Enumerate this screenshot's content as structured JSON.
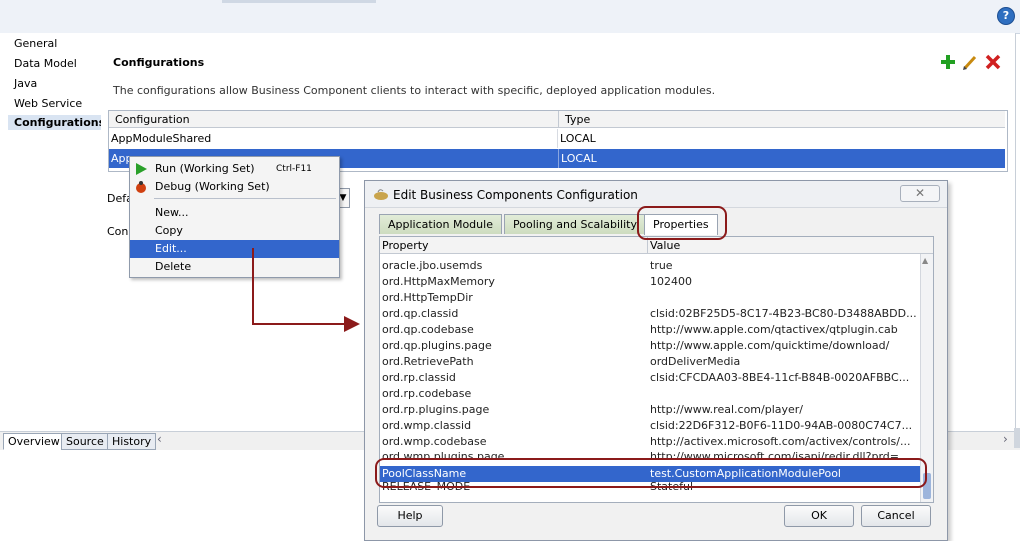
{
  "nav": {
    "items": [
      {
        "label": "General",
        "selected": false
      },
      {
        "label": "Data Model",
        "selected": false
      },
      {
        "label": "Java",
        "selected": false
      },
      {
        "label": "Web Service",
        "selected": false
      },
      {
        "label": "Configurations",
        "selected": true
      }
    ]
  },
  "panel": {
    "title": "Configurations",
    "description": "The configurations allow Business Component clients to interact with specific, deployed application modules.",
    "table": {
      "columns": [
        "Configuration",
        "Type"
      ],
      "rows": [
        {
          "name": "AppModuleShared",
          "type": "LOCAL"
        },
        {
          "name": "AppModuleLocal",
          "name_visible": "App",
          "type": "LOCAL"
        }
      ]
    },
    "partial_labels": {
      "default": "Defa",
      "config": "Con"
    }
  },
  "context_menu": {
    "items": [
      {
        "label": "Run (Working Set)",
        "accelerator": "Ctrl-F11",
        "icon": "run-icon"
      },
      {
        "label": "Debug (Working Set)",
        "accelerator": "",
        "icon": "debug-icon"
      },
      {
        "label": "New...",
        "accelerator": ""
      },
      {
        "label": "Copy",
        "accelerator": ""
      },
      {
        "label": "Edit...",
        "accelerator": "",
        "highlighted": true
      },
      {
        "label": "Delete",
        "accelerator": ""
      }
    ]
  },
  "dialog": {
    "title": "Edit Business Components Configuration",
    "tabs": [
      "Application Module",
      "Pooling and Scalability",
      "Properties"
    ],
    "active_tab": "Properties",
    "columns": [
      "Property",
      "Value"
    ],
    "properties": [
      {
        "name": "oracle.jbo.usemds",
        "value": "true"
      },
      {
        "name": "ord.HttpMaxMemory",
        "value": "102400"
      },
      {
        "name": "ord.HttpTempDir",
        "value": ""
      },
      {
        "name": "ord.qp.classid",
        "value": "clsid:02BF25D5-8C17-4B23-BC80-D3488ABDD..."
      },
      {
        "name": "ord.qp.codebase",
        "value": "http://www.apple.com/qtactivex/qtplugin.cab"
      },
      {
        "name": "ord.qp.plugins.page",
        "value": "http://www.apple.com/quicktime/download/"
      },
      {
        "name": "ord.RetrievePath",
        "value": "ordDeliverMedia"
      },
      {
        "name": "ord.rp.classid",
        "value": "clsid:CFCDAA03-8BE4-11cf-B84B-0020AFBBC..."
      },
      {
        "name": "ord.rp.codebase",
        "value": ""
      },
      {
        "name": "ord.rp.plugins.page",
        "value": "http://www.real.com/player/"
      },
      {
        "name": "ord.wmp.classid",
        "value": "clsid:22D6F312-B0F6-11D0-94AB-0080C74C7..."
      },
      {
        "name": "ord.wmp.codebase",
        "value": "http://activex.microsoft.com/activex/controls/..."
      },
      {
        "name": "ord.wmp.plugins.page",
        "value": "http://www.microsoft.com/isapi/redir.dll?prd="
      },
      {
        "name": "PoolClassName",
        "value": "test.CustomApplicationModulePool",
        "selected": true
      },
      {
        "name": "RELEASE_MODE",
        "value": "Stateful"
      }
    ],
    "buttons": {
      "help": "Help",
      "ok": "OK",
      "cancel": "Cancel"
    }
  },
  "bottom_tabs": [
    "Overview",
    "Source",
    "History"
  ],
  "colors": {
    "selection": "#3366cc",
    "annotation": "#8b1a1a",
    "add": "#22a022",
    "remove": "#d02020"
  }
}
